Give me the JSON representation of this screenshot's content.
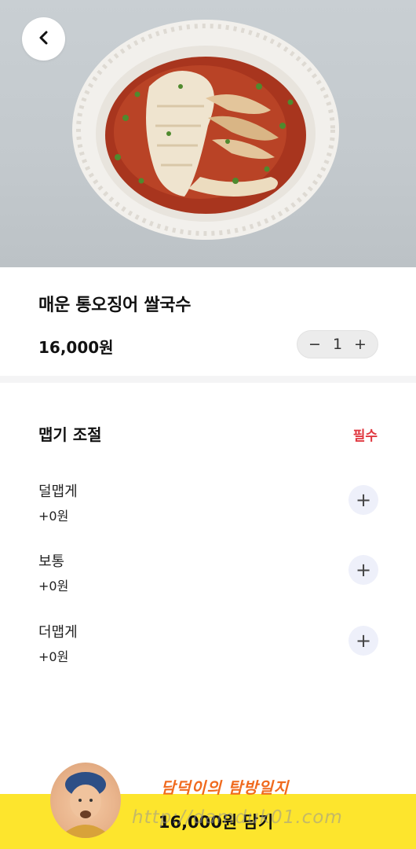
{
  "product": {
    "name": "매운 통오징어 쌀국수",
    "price": "16,000원",
    "quantity": "1",
    "decrement_symbol": "−",
    "increment_symbol": "+"
  },
  "options_section": {
    "title": "맵기 조절",
    "required_label": "필수",
    "items": [
      {
        "label": "덜맵게",
        "price": "+0원"
      },
      {
        "label": "보통",
        "price": "+0원"
      },
      {
        "label": "더맵게",
        "price": "+0원"
      }
    ]
  },
  "cta": {
    "label": "16,000원 담기"
  },
  "watermark": {
    "title": "담덕이의 탐방일지",
    "url": "http://damduk01.com"
  },
  "icons": {
    "back": "chevron-left-icon",
    "add": "plus-icon"
  },
  "colors": {
    "accent_yellow": "#fde52d",
    "required_red": "#e0373f",
    "add_button_bg": "#eef0fa"
  }
}
